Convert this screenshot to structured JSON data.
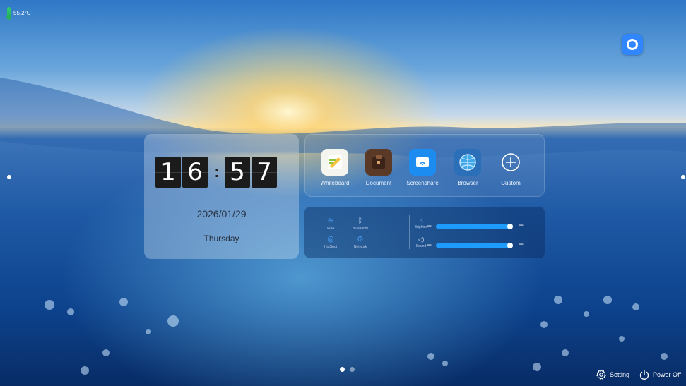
{
  "status": {
    "temperature": "55.2°C"
  },
  "clock": {
    "hour_tens": "1",
    "hour_ones": "6",
    "separator": ":",
    "minute_tens": "5",
    "minute_ones": "7",
    "date": "2026/01/29",
    "weekday": "Thursday"
  },
  "apps": [
    {
      "label": "Whiteboard",
      "icon": "whiteboard-icon"
    },
    {
      "label": "Document",
      "icon": "document-icon"
    },
    {
      "label": "Screenshare",
      "icon": "screenshare-icon"
    },
    {
      "label": "Browser",
      "icon": "browser-icon"
    },
    {
      "label": "Custom",
      "icon": "add-icon"
    }
  ],
  "quick_settings": [
    {
      "label": "WiFi",
      "icon": "wifi-icon"
    },
    {
      "label": "BlueTooth",
      "icon": "bluetooth-icon"
    },
    {
      "label": "HotSpot",
      "icon": "hotspot-icon"
    },
    {
      "label": "Network",
      "icon": "network-icon"
    }
  ],
  "sliders": {
    "brightness": {
      "label": "Brightne",
      "level": 0.97,
      "icon": "sun-icon"
    },
    "sound": {
      "label": "Sound",
      "level": 0.97,
      "icon": "speaker-icon"
    }
  },
  "pagination": {
    "pages": 2,
    "current": 1
  },
  "footer": {
    "setting_label": "Setting",
    "power_label": "Power Off"
  },
  "colors": {
    "accent": "#1e9bff",
    "clock_digit_bg": "#1b1b1b"
  }
}
